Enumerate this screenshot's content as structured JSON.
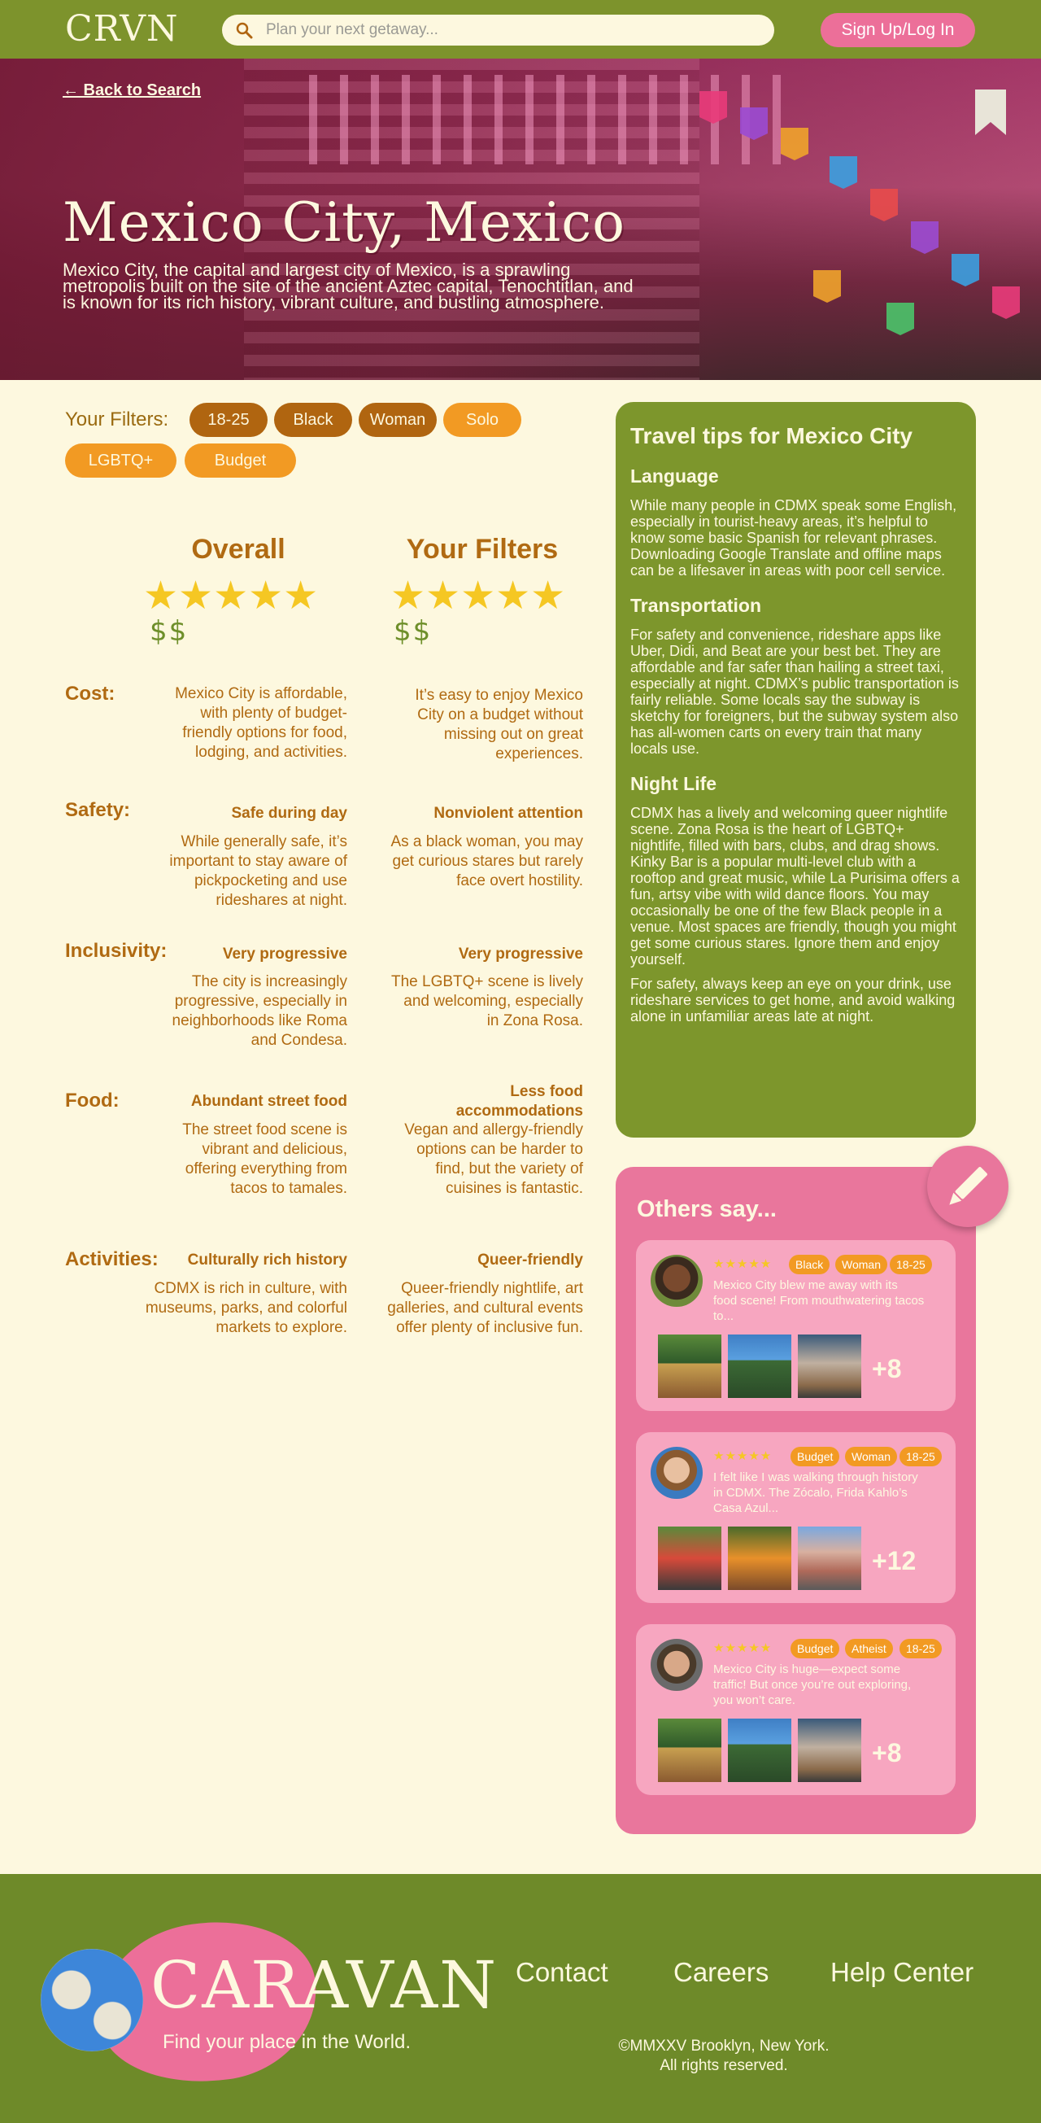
{
  "nav": {
    "logo": "CRVN",
    "search_placeholder": "Plan your next getaway...",
    "signup_label": "Sign Up/Log In"
  },
  "hero": {
    "back_label": "← Back to Search",
    "title": "Mexico City, Mexico",
    "description": "Mexico City, the capital and largest city of Mexico, is a sprawling metropolis built on the site of the ancient Aztec capital, Tenochtitlan, and is known for its rich history, vibrant culture, and bustling atmosphere."
  },
  "filters": {
    "label": "Your Filters:",
    "chips": [
      "18-25",
      "Black",
      "Woman",
      "Solo",
      "LGBTQ+",
      "Budget"
    ]
  },
  "ratings": {
    "overall_label": "Overall",
    "filters_label": "Your Filters",
    "overall_stars": 5,
    "filters_stars": 5,
    "overall_price": "$$",
    "filters_price": "$$",
    "categories": [
      {
        "label": "Cost:",
        "overall": {
          "heading": "",
          "text": "Mexico City is affordable, with plenty of budget-friendly options for food, lodging, and activities."
        },
        "filtered": {
          "heading": "",
          "text": "It’s easy to enjoy Mexico City on a budget without missing out on great experiences."
        }
      },
      {
        "label": "Safety:",
        "overall": {
          "heading": "Safe during day",
          "text": "While generally safe, it’s important to stay aware of pickpocketing and use rideshares at night."
        },
        "filtered": {
          "heading": "Nonviolent attention",
          "text": "As a black woman, you may get curious stares but rarely face overt hostility."
        }
      },
      {
        "label": "Inclusivity:",
        "overall": {
          "heading": "Very progressive",
          "text": "The city is increasingly progressive, especially in neighborhoods like Roma and Condesa."
        },
        "filtered": {
          "heading": "Very progressive",
          "text": "The LGBTQ+ scene is lively and welcoming, especially in Zona Rosa."
        }
      },
      {
        "label": "Food:",
        "overall": {
          "heading": "Abundant street food",
          "text": "The street food scene is vibrant and delicious, offering everything from tacos to tamales."
        },
        "filtered": {
          "heading": "Less food accommodations",
          "text": "Vegan and allergy-friendly options can be harder to find, but the variety of cuisines is fantastic."
        }
      },
      {
        "label": "Activities:",
        "overall": {
          "heading": "Culturally rich history",
          "text": "CDMX is rich in culture, with museums, parks, and colorful markets to explore."
        },
        "filtered": {
          "heading": "Queer-friendly",
          "text": "Queer-friendly nightlife, art galleries, and cultural events offer plenty of inclusive fun."
        }
      }
    ]
  },
  "tips": {
    "title": "Travel tips for Mexico City",
    "sections": [
      {
        "heading": "Language",
        "text": "While many people in CDMX speak some English, especially in tourist-heavy areas, it’s helpful to know some basic Spanish for relevant phrases. Downloading Google Translate and offline maps can be a lifesaver in areas with poor cell service."
      },
      {
        "heading": "Transportation",
        "text": "For safety and convenience, rideshare apps like Uber, Didi, and Beat are your best bet. They are affordable and far safer than hailing a street taxi, especially at night. CDMX’s public transportation is fairly reliable. Some locals say the subway is sketchy for foreigners, but the subway system also has all-women carts on every train that many locals use."
      },
      {
        "heading": "Night Life",
        "text": "CDMX has a lively and welcoming queer nightlife scene. Zona Rosa is the heart of LGBTQ+ nightlife, filled with bars, clubs, and drag shows. Kinky Bar is a popular multi-level club with a rooftop and great music, while La Purisima offers a fun, artsy vibe with wild dance floors. You may occasionally be one of the few Black people in a venue. Most spaces are friendly, though you might get some curious stares. Ignore them and enjoy yourself.",
        "extra": "For safety, always keep an eye on your drink, use rideshare services to get home, and avoid walking alone in unfamiliar areas late at night."
      }
    ]
  },
  "others": {
    "title": "Others say...",
    "reviews": [
      {
        "stars": 5,
        "tags": [
          "Black",
          "Woman",
          "18-25"
        ],
        "text": "Mexico City blew me away with its food scene! From mouthwatering tacos to...",
        "more": "+8"
      },
      {
        "stars": 5,
        "tags": [
          "Budget",
          "Woman",
          "18-25"
        ],
        "text": "I felt like I was walking through history in CDMX. The Zócalo, Frida Kahlo’s Casa Azul...",
        "more": "+12"
      },
      {
        "stars": 5,
        "tags": [
          "Budget",
          "Atheist",
          "18-25"
        ],
        "text": "Mexico City is huge—expect some traffic! But once you’re out exploring, you won’t care.",
        "more": "+8"
      }
    ]
  },
  "footer": {
    "brand": "CARAVAN",
    "tagline": "Find your place in the World.",
    "links": [
      "Contact",
      "Careers",
      "Help Center"
    ],
    "copyright_line1": "©MMXXV Brooklyn, New York.",
    "copyright_line2": "All rights reserved."
  },
  "colors": {
    "nav_green": "#7d932c",
    "cream": "#fdf8df",
    "accent_pink": "#ec6f99",
    "chip_dark": "#b06510",
    "chip_light": "#f29a23",
    "text_brown": "#b06a12",
    "star_yellow": "#f5c723"
  },
  "icons": [
    "search-icon",
    "bookmark-icon",
    "pencil-icon",
    "globe-icon"
  ]
}
